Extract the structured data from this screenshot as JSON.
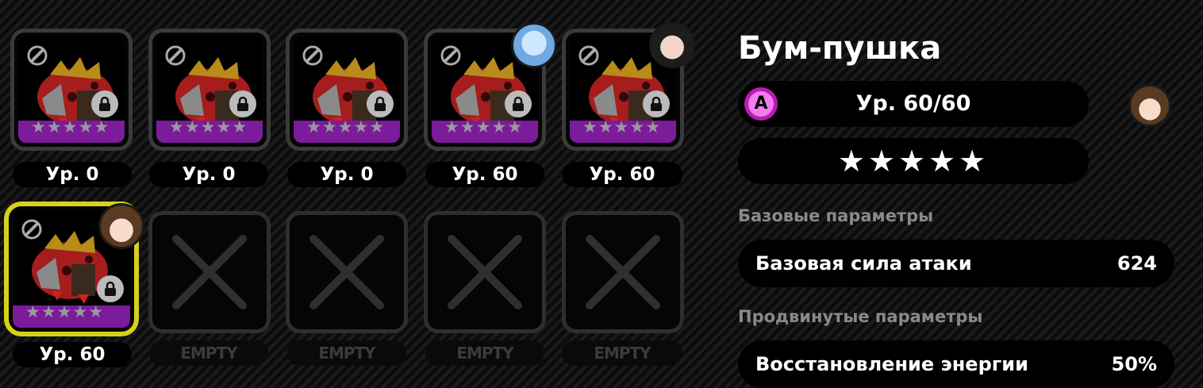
{
  "slots": [
    {
      "level": "Ур. 0",
      "stars": 5,
      "locked": true,
      "has_user": false
    },
    {
      "level": "Ур. 0",
      "stars": 5,
      "locked": true,
      "has_user": false
    },
    {
      "level": "Ур. 0",
      "stars": 5,
      "locked": true,
      "has_user": false
    },
    {
      "level": "Ур. 60",
      "stars": 5,
      "locked": true,
      "has_user": true
    },
    {
      "level": "Ур. 60",
      "stars": 5,
      "locked": true,
      "has_user": true
    },
    {
      "level": "Ур. 60",
      "stars": 5,
      "locked": true,
      "has_user": true,
      "selected": true
    }
  ],
  "empty_slots": [
    {
      "label": "EMPTY"
    },
    {
      "label": "EMPTY"
    },
    {
      "label": "EMPTY"
    },
    {
      "label": "EMPTY"
    }
  ],
  "detail": {
    "title": "Бум-пушка",
    "rank": "A",
    "level": "Ур. 60/60",
    "stars": 5,
    "base_section": "Базовые параметры",
    "base_stat": {
      "name": "Базовая сила атаки",
      "value": "624"
    },
    "adv_section": "Продвинутые параметры",
    "adv_stat": {
      "name": "Восстановление энергии",
      "value": "50%"
    }
  },
  "colors": {
    "rarity": "#7b1c9a",
    "selected": "#d6d21a",
    "rank": "#b91cb0"
  }
}
